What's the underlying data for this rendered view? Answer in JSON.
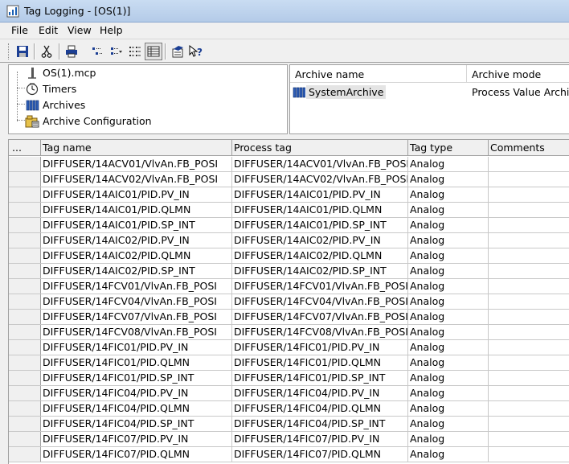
{
  "window": {
    "title": "Tag Logging - [OS(1)]"
  },
  "menu": [
    "File",
    "Edit",
    "View",
    "Help"
  ],
  "toolbar": {
    "icons": [
      "save-icon",
      "cut-icon",
      "print-icon",
      "view-large-icons-icon",
      "view-small-icons-icon",
      "view-list-icon",
      "view-details-icon",
      "properties-icon",
      "context-help-icon"
    ]
  },
  "tree": {
    "items": [
      {
        "label": "OS(1).mcp",
        "icon": "project-icon"
      },
      {
        "label": "Timers",
        "icon": "timer-icon"
      },
      {
        "label": "Archives",
        "icon": "archive-icon"
      },
      {
        "label": "Archive Configuration",
        "icon": "archive-config-icon"
      }
    ]
  },
  "archives": {
    "columns": [
      "Archive name",
      "Archive mode"
    ],
    "rows": [
      {
        "name": "SystemArchive",
        "mode": "Process Value Archive"
      }
    ]
  },
  "grid": {
    "columns": [
      "...",
      "Tag name",
      "Process tag",
      "Tag type",
      "Comments"
    ],
    "rows": [
      [
        "DIFFUSER/14ACV01/VlvAn.FB_POSI",
        "DIFFUSER/14ACV01/VlvAn.FB_POSI",
        "Analog",
        ""
      ],
      [
        "DIFFUSER/14ACV02/VlvAn.FB_POSI",
        "DIFFUSER/14ACV02/VlvAn.FB_POSI",
        "Analog",
        ""
      ],
      [
        "DIFFUSER/14AIC01/PID.PV_IN",
        "DIFFUSER/14AIC01/PID.PV_IN",
        "Analog",
        ""
      ],
      [
        "DIFFUSER/14AIC01/PID.QLMN",
        "DIFFUSER/14AIC01/PID.QLMN",
        "Analog",
        ""
      ],
      [
        "DIFFUSER/14AIC01/PID.SP_INT",
        "DIFFUSER/14AIC01/PID.SP_INT",
        "Analog",
        ""
      ],
      [
        "DIFFUSER/14AIC02/PID.PV_IN",
        "DIFFUSER/14AIC02/PID.PV_IN",
        "Analog",
        ""
      ],
      [
        "DIFFUSER/14AIC02/PID.QLMN",
        "DIFFUSER/14AIC02/PID.QLMN",
        "Analog",
        ""
      ],
      [
        "DIFFUSER/14AIC02/PID.SP_INT",
        "DIFFUSER/14AIC02/PID.SP_INT",
        "Analog",
        ""
      ],
      [
        "DIFFUSER/14FCV01/VlvAn.FB_POSI",
        "DIFFUSER/14FCV01/VlvAn.FB_POSI",
        "Analog",
        ""
      ],
      [
        "DIFFUSER/14FCV04/VlvAn.FB_POSI",
        "DIFFUSER/14FCV04/VlvAn.FB_POSI",
        "Analog",
        ""
      ],
      [
        "DIFFUSER/14FCV07/VlvAn.FB_POSI",
        "DIFFUSER/14FCV07/VlvAn.FB_POSI",
        "Analog",
        ""
      ],
      [
        "DIFFUSER/14FCV08/VlvAn.FB_POSI",
        "DIFFUSER/14FCV08/VlvAn.FB_POSI",
        "Analog",
        ""
      ],
      [
        "DIFFUSER/14FIC01/PID.PV_IN",
        "DIFFUSER/14FIC01/PID.PV_IN",
        "Analog",
        ""
      ],
      [
        "DIFFUSER/14FIC01/PID.QLMN",
        "DIFFUSER/14FIC01/PID.QLMN",
        "Analog",
        ""
      ],
      [
        "DIFFUSER/14FIC01/PID.SP_INT",
        "DIFFUSER/14FIC01/PID.SP_INT",
        "Analog",
        ""
      ],
      [
        "DIFFUSER/14FIC04/PID.PV_IN",
        "DIFFUSER/14FIC04/PID.PV_IN",
        "Analog",
        ""
      ],
      [
        "DIFFUSER/14FIC04/PID.QLMN",
        "DIFFUSER/14FIC04/PID.QLMN",
        "Analog",
        ""
      ],
      [
        "DIFFUSER/14FIC04/PID.SP_INT",
        "DIFFUSER/14FIC04/PID.SP_INT",
        "Analog",
        ""
      ],
      [
        "DIFFUSER/14FIC07/PID.PV_IN",
        "DIFFUSER/14FIC07/PID.PV_IN",
        "Analog",
        ""
      ],
      [
        "DIFFUSER/14FIC07/PID.QLMN",
        "DIFFUSER/14FIC07/PID.QLMN",
        "Analog",
        ""
      ]
    ]
  }
}
